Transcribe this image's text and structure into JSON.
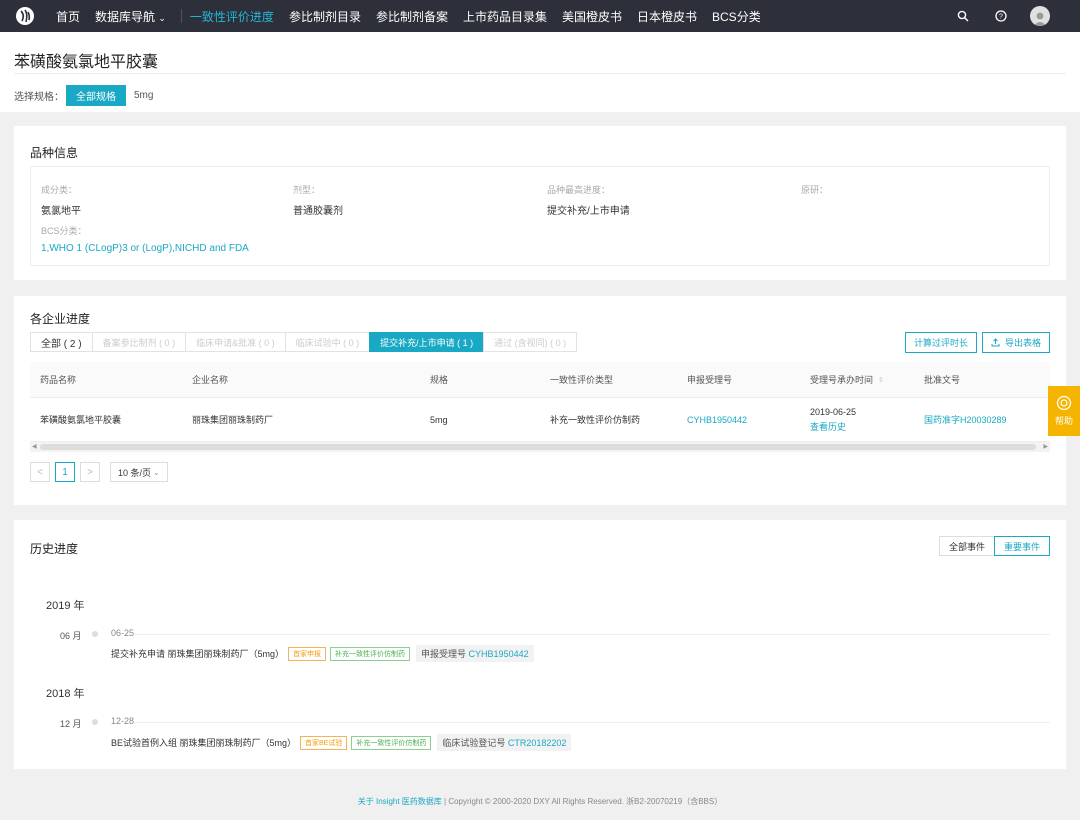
{
  "nav": {
    "items": [
      {
        "label": "首页"
      },
      {
        "label": "数据库导航",
        "chevron": "⌄"
      },
      {
        "label": "一致性评价进度",
        "active": true
      },
      {
        "label": "参比制剂目录"
      },
      {
        "label": "参比制剂备案"
      },
      {
        "label": "上市药品目录集"
      },
      {
        "label": "美国橙皮书"
      },
      {
        "label": "日本橙皮书"
      },
      {
        "label": "BCS分类"
      }
    ],
    "icons": [
      "search-icon",
      "help-circle-icon",
      "avatar"
    ]
  },
  "header": {
    "title": "苯磺酸氨氯地平胶囊",
    "spec_label": "选择规格：",
    "spec_all": "全部规格",
    "spec_option": "5mg"
  },
  "variety": {
    "title": "品种信息",
    "fields": [
      {
        "label": "成分类：",
        "value": "氨氯地平"
      },
      {
        "label": "剂型：",
        "value": "普通胶囊剂"
      },
      {
        "label": "品种最高进度：",
        "value": "提交补充/上市申请"
      },
      {
        "label": "原研：",
        "value": ""
      }
    ],
    "bcs": {
      "label": "BCS分类：",
      "value": "1,WHO 1 (CLogP)3 or (LogP),NICHD and FDA"
    }
  },
  "progress": {
    "title": "各企业进度",
    "tabs": [
      {
        "label": "全部 ( 2 )"
      },
      {
        "label": "备案参比制剂 ( 0 )"
      },
      {
        "label": "临床申请&批准 ( 0 )"
      },
      {
        "label": "临床试验中 ( 0 )"
      },
      {
        "label": "提交补充/上市申请 ( 1 )",
        "active": true
      },
      {
        "label": "通过 (含视同) ( 0 )"
      }
    ],
    "calc_button": "计算过评时长",
    "export_button": "导出表格",
    "columns": [
      "药品名称",
      "企业名称",
      "规格",
      "一致性评价类型",
      "申报受理号",
      "受理号承办时间",
      "批准文号"
    ],
    "rows": [
      {
        "drug": "苯磺酸氨氯地平胶囊",
        "company": "丽珠集团丽珠制药厂",
        "spec": "5mg",
        "type": "补充一致性评价仿制药",
        "accept_no": "CYHB1950442",
        "date": "2019-06-25",
        "history_link": "查看历史",
        "approval_no": "国药准字H20030289"
      }
    ],
    "pagination": {
      "current": "1",
      "prev": "<",
      "next": ">",
      "page_size": "10 条/页"
    }
  },
  "history": {
    "title": "历史进度",
    "filter_all": "全部事件",
    "filter_important": "重要事件",
    "years": [
      {
        "year": "2019 年",
        "month": "06 月",
        "date": "06-25",
        "event": "提交补充申请 丽珠集团丽珠制药厂（5mg）",
        "tags": [
          "首家申报",
          "补充一致性评价仿制药"
        ],
        "extra_label": "申报受理号",
        "extra_value": "CYHB1950442"
      },
      {
        "year": "2018 年",
        "month": "12 月",
        "date": "12-28",
        "event": "BE试验首例入组 丽珠集团丽珠制药厂（5mg）",
        "tags": [
          "首家BE试验",
          "补充一致性评价仿制药"
        ],
        "extra_label": "临床试验登记号",
        "extra_value": "CTR20182202"
      }
    ]
  },
  "footer": {
    "link": "关于 Insight 医药数据库",
    "text": " | Copyright © 2000-2020 DXY All Rights Reserved. 浙B2-20070219（含BBS）"
  },
  "help_label": "帮助"
}
